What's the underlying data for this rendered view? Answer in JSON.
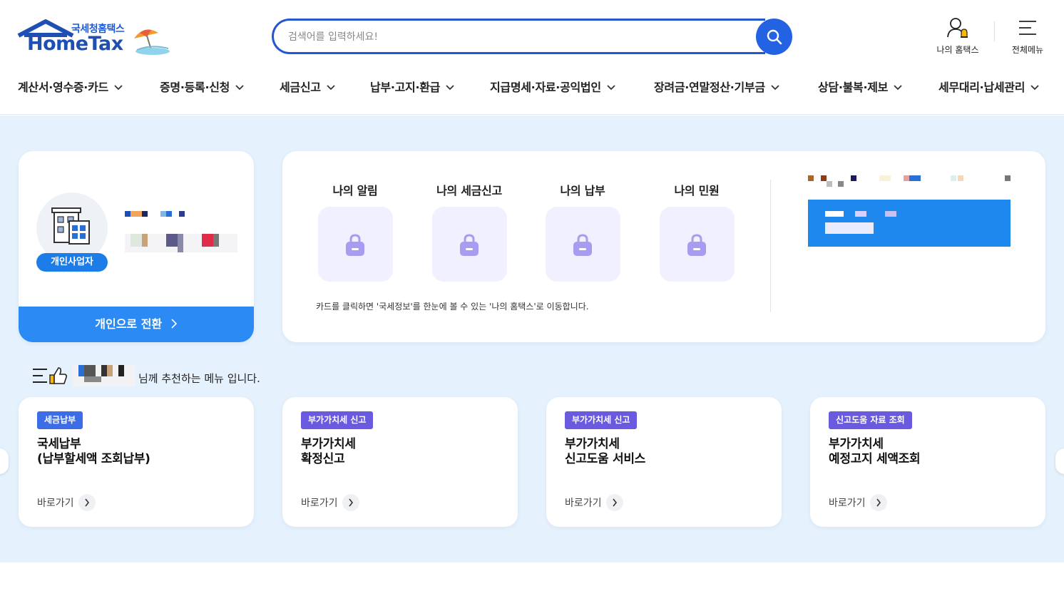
{
  "logo": {
    "sub": "국세청홈택스",
    "main": "HomeTax"
  },
  "search": {
    "placeholder": "검색어를 입력하세요!"
  },
  "header_utils": [
    {
      "label": "나의 홈택스",
      "icon": "person-bell-icon"
    },
    {
      "label": "전체메뉴",
      "icon": "hamburger-menu-icon"
    }
  ],
  "nav": [
    "계산서·영수증·카드",
    "증명·등록·신청",
    "세금신고",
    "납부·고지·환급",
    "지급명세·자료·공익법인",
    "장려금·연말정산·기부금",
    "상담·불복·제보",
    "세무대리·납세관리"
  ],
  "profile": {
    "badge": "개인사업자",
    "switch_label": "개인으로 전환"
  },
  "my_hometax": {
    "items": [
      "나의 알림",
      "나의 세금신고",
      "나의 납부",
      "나의 민원"
    ],
    "note": "카드를 클릭하면 '국세정보'를 한눈에 볼 수 있는 '나의 홈택스'로 이동합니다."
  },
  "recommend": {
    "suffix": "님께 추천하는 메뉴 입니다."
  },
  "cards": [
    {
      "tag": "세금납부",
      "tag_color": "#3c6ce6",
      "line1": "국세납부",
      "line2": "(납부할세액 조회납부)",
      "go": "바로가기"
    },
    {
      "tag": "부가가치세 신고",
      "tag_color": "#6a5ae0",
      "line1": "부가가치세",
      "line2": "확정신고",
      "go": "바로가기"
    },
    {
      "tag": "부가가치세 신고",
      "tag_color": "#6a5ae0",
      "line1": "부가가치세",
      "line2": "신고도움 서비스",
      "go": "바로가기"
    },
    {
      "tag": "신고도움 자료 조회",
      "tag_color": "#6a5ae0",
      "line1": "부가가치세",
      "line2": "예정고지 세액조회",
      "go": "바로가기"
    }
  ],
  "colors": {
    "accent": "#2363e3",
    "main_bg": "#e5f1fc",
    "switch_bar": "#2b8af3",
    "lock": "#a89cf0"
  }
}
